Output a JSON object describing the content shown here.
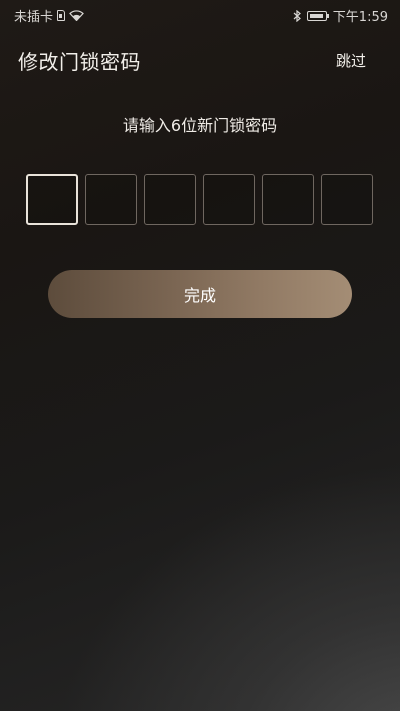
{
  "status_bar": {
    "carrier": "未插卡",
    "time": "下午1:59",
    "icons": [
      "sim-icon",
      "wifi-icon",
      "bluetooth-icon",
      "battery-icon"
    ]
  },
  "header": {
    "title": "修改门锁密码",
    "skip_label": "跳过"
  },
  "form": {
    "prompt": "请输入6位新门锁密码",
    "digit_count": 6,
    "active_index": 0,
    "submit_label": "完成"
  },
  "colors": {
    "button_gradient_start": "#5d4c3c",
    "button_gradient_end": "#a48d75",
    "active_box_border": "#e9e3da",
    "box_border": "#6f6760"
  }
}
